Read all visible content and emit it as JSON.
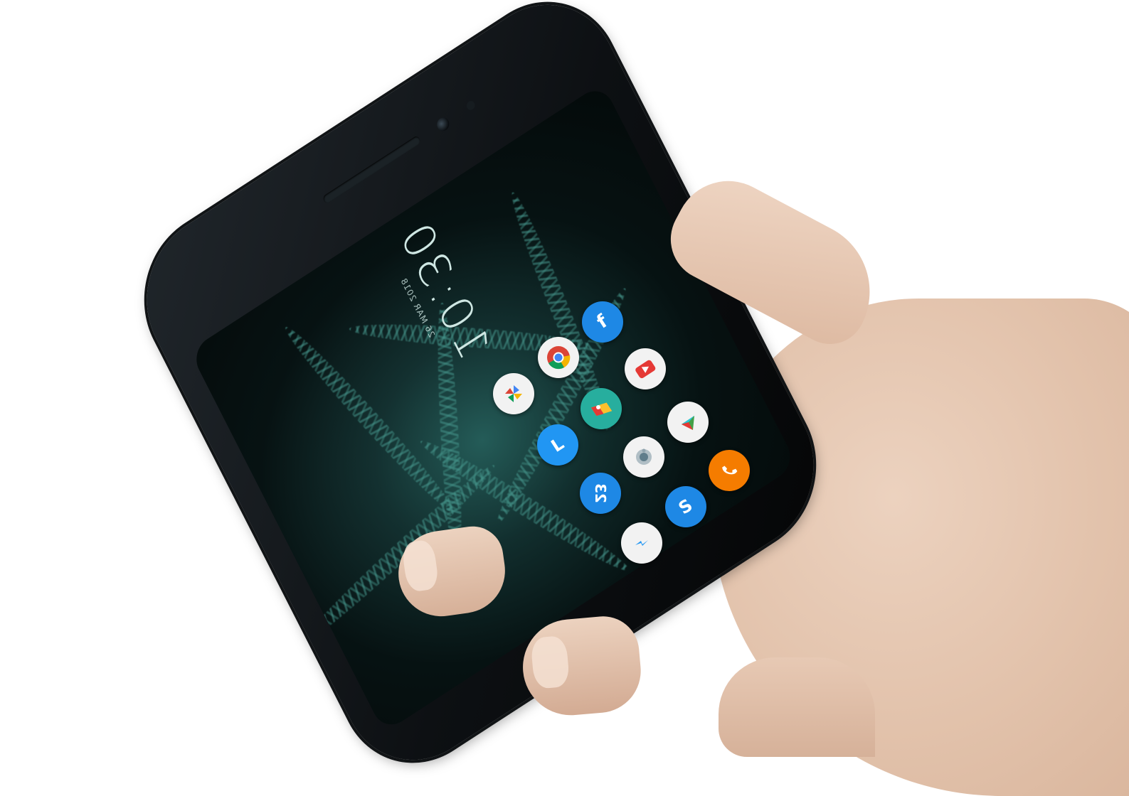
{
  "lockscreen": {
    "clock": {
      "time": "10:30",
      "date": "26 MAR 2018"
    }
  },
  "apps": [
    {
      "name": "facebook",
      "glyph": "f",
      "color": "#1e88e5"
    },
    {
      "name": "chrome",
      "glyph": "",
      "color": "#f2f2f2"
    },
    {
      "name": "youtube",
      "glyph": "",
      "color": "#f2f2f2"
    },
    {
      "name": "pinwheel",
      "glyph": "",
      "color": "#f2f2f2"
    },
    {
      "name": "maps",
      "glyph": "",
      "color": "#27ae9e"
    },
    {
      "name": "play-store",
      "glyph": "",
      "color": "#f2f2f2"
    },
    {
      "name": "clock-app",
      "glyph": "L",
      "color": "#2196f3"
    },
    {
      "name": "camera-app",
      "glyph": "",
      "color": "#f2f2f2"
    },
    {
      "name": "phone-app",
      "glyph": "",
      "color": "#f57c00"
    },
    {
      "name": "calendar-app",
      "glyph": "23",
      "color": "#1e88e5"
    },
    {
      "name": "skype",
      "glyph": "S",
      "color": "#1e88e5"
    },
    {
      "name": "messenger",
      "glyph": "",
      "color": "#f2f2f2"
    }
  ]
}
